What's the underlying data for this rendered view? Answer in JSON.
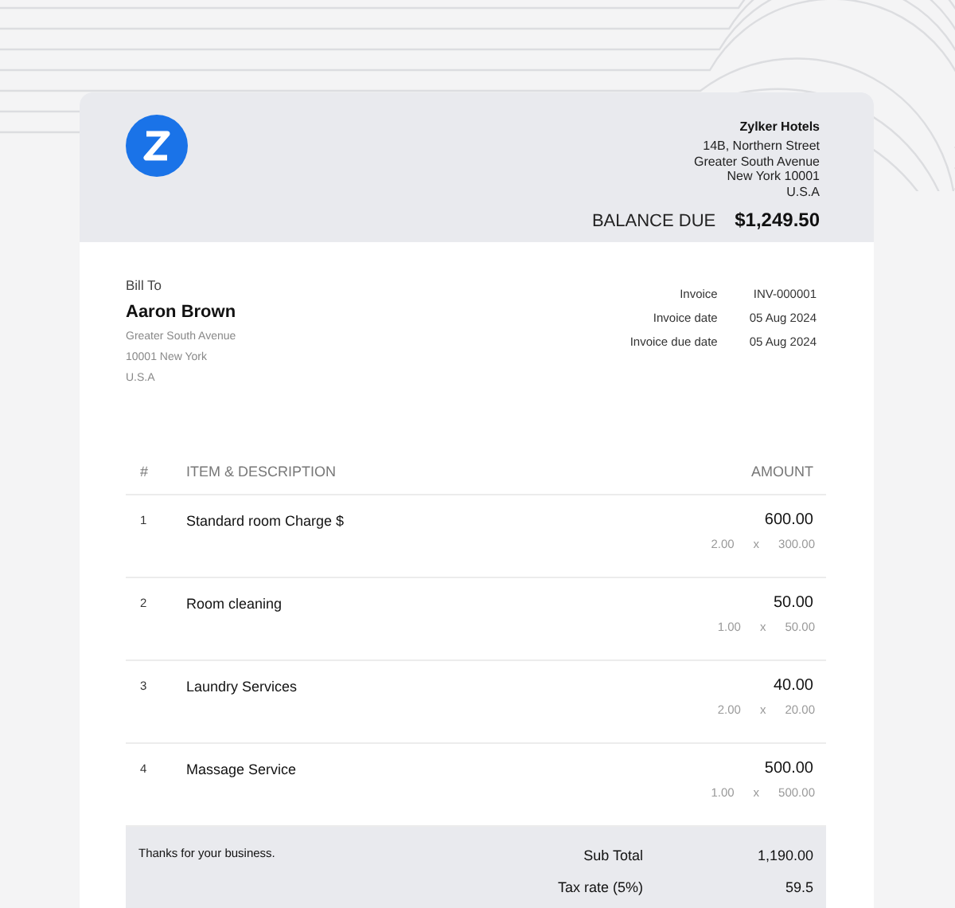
{
  "company": {
    "name": "Zylker Hotels",
    "address": [
      "14B, Northern Street",
      "Greater South Avenue",
      "New York 10001",
      "U.S.A"
    ]
  },
  "balance_due": {
    "label": "BALANCE DUE",
    "amount": "$1,249.50"
  },
  "bill_to": {
    "label": "Bill To",
    "name": "Aaron Brown",
    "address": [
      "Greater South Avenue",
      "10001 New York",
      "U.S.A"
    ]
  },
  "invoice_details": [
    {
      "label": "Invoice",
      "value": "INV-000001"
    },
    {
      "label": "Invoice date",
      "value": "05 Aug 2024"
    },
    {
      "label": "Invoice due date",
      "value": "05 Aug 2024"
    }
  ],
  "table": {
    "columns": [
      "#",
      "ITEM & DESCRIPTION",
      "AMOUNT"
    ],
    "rows": [
      {
        "number": "1",
        "item": "Standard room Charge $",
        "amount": "600.00",
        "quantity": "2.00",
        "times": "x",
        "rate": "300.00"
      },
      {
        "number": "2",
        "item": "Room cleaning",
        "amount": "50.00",
        "quantity": "1.00",
        "times": "x",
        "rate": "50.00"
      },
      {
        "number": "3",
        "item": "Laundry Services",
        "amount": "40.00",
        "quantity": "2.00",
        "times": "x",
        "rate": "20.00"
      },
      {
        "number": "4",
        "item": "Massage Service",
        "amount": "500.00",
        "quantity": "1.00",
        "times": "x",
        "rate": "500.00"
      }
    ]
  },
  "footer": {
    "note": "Thanks for your business.",
    "totals": [
      {
        "label": "Sub Total",
        "value": "1,190.00"
      },
      {
        "label": "Tax rate (5%)",
        "value": "59.5"
      }
    ]
  }
}
